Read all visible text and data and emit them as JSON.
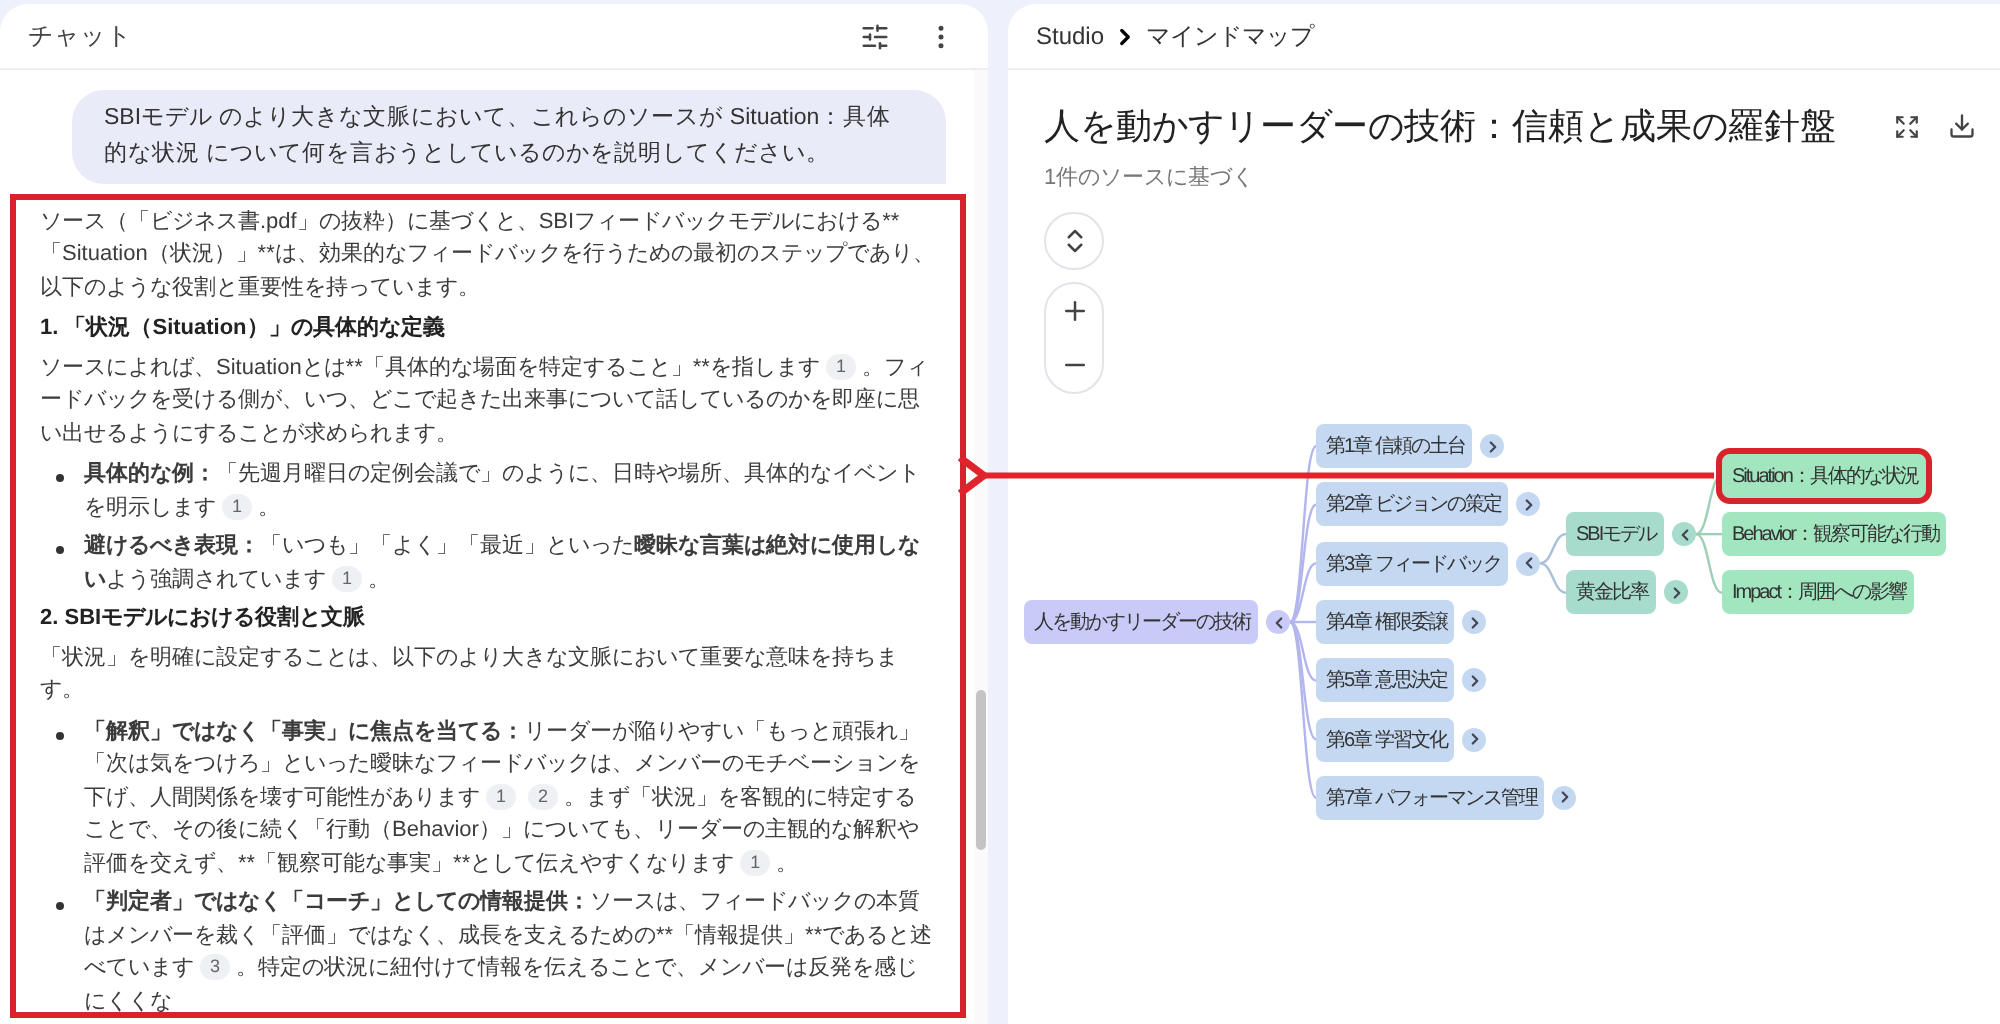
{
  "chat": {
    "title": "チャット",
    "question": "SBIモデル のより大きな文脈において、これらのソースが Situation：具体的な状況 について何を言おうとしているのかを説明してください。",
    "answer": {
      "highlighted": true,
      "blocks": [
        {
          "kind": "paragraph",
          "parts": [
            {
              "kind": "text",
              "text": "ソース（「ビジネス書.pdf」の抜粋）に基づくと、SBIフィードバックモデルにおける**「Situation（状況）」**は、効果的なフィードバックを行うための最初のステップであり、以下のような役割と重要性を持っています。"
            }
          ]
        },
        {
          "kind": "heading",
          "text": "1. 「状況（Situation）」の具体的な定義"
        },
        {
          "kind": "paragraph",
          "parts": [
            {
              "kind": "text",
              "text": "ソースによれば、Situationとは**「具体的な場面を特定すること」**を指します"
            },
            {
              "kind": "cite",
              "text": "1"
            },
            {
              "kind": "text",
              "text": "。フィードバックを受ける側が、いつ、どこで起きた出来事について話しているのかを即座に思い出せるようにすることが求められます。"
            }
          ]
        },
        {
          "kind": "bullet",
          "parts": [
            {
              "kind": "bold",
              "text": "具体的な例："
            },
            {
              "kind": "text",
              "text": "「先週月曜日の定例会議で」のように、日時や場所、具体的なイベントを明示します"
            },
            {
              "kind": "cite",
              "text": "1"
            },
            {
              "kind": "text",
              "text": "。"
            }
          ]
        },
        {
          "kind": "bullet",
          "parts": [
            {
              "kind": "bold",
              "text": "避けるべき表現："
            },
            {
              "kind": "text",
              "text": "「いつも」「よく」「最近」といった"
            },
            {
              "kind": "bold",
              "text": "曖昧な言葉は絶対に使用しない"
            },
            {
              "kind": "text",
              "text": "よう強調されています"
            },
            {
              "kind": "cite",
              "text": "1"
            },
            {
              "kind": "text",
              "text": "。"
            }
          ]
        },
        {
          "kind": "heading",
          "text": "2. SBIモデルにおける役割と文脈"
        },
        {
          "kind": "paragraph",
          "parts": [
            {
              "kind": "text",
              "text": "「状況」を明確に設定することは、以下のより大きな文脈において重要な意味を持ちます。"
            }
          ]
        },
        {
          "kind": "bullet",
          "parts": [
            {
              "kind": "bold",
              "text": "「解釈」ではなく「事実」に焦点を当てる："
            },
            {
              "kind": "text",
              "text": "リーダーが陥りやすい「もっと頑張れ」「次は気をつけろ」といった曖昧なフィードバックは、メンバーのモチベーションを下げ、人間関係を壊す可能性があります"
            },
            {
              "kind": "cite",
              "text": "1"
            },
            {
              "kind": "cite",
              "text": "2"
            },
            {
              "kind": "text",
              "text": "。まず「状況」を客観的に特定することで、その後に続く「行動（Behavior）」についても、リーダーの主観的な解釈や評価を交えず、**「観察可能な事実」**として伝えやすくなります"
            },
            {
              "kind": "cite",
              "text": "1"
            },
            {
              "kind": "text",
              "text": "。"
            }
          ]
        },
        {
          "kind": "bullet",
          "parts": [
            {
              "kind": "bold",
              "text": "「判定者」ではなく「コーチ」としての情報提供："
            },
            {
              "kind": "text",
              "text": "ソースは、フィードバックの本質はメンバーを裁く「評価」ではなく、成長を支えるための**「情報提供」**であると述べています"
            },
            {
              "kind": "cite",
              "text": "3"
            },
            {
              "kind": "text",
              "text": "。特定の状況に紐付けて情報を伝えることで、メンバーは反発を感じにくくな"
            }
          ]
        }
      ]
    }
  },
  "studio": {
    "breadcrumb": [
      "Studio",
      "マインドマップ"
    ],
    "title": "人を動かすリーダーの技術：信頼と成果の羅針盤",
    "subtitle": "1件のソースに基づく",
    "mindmap": {
      "root": {
        "label": "人を動かすリーダーの技術",
        "expanded": true,
        "children": [
          {
            "label": "第1章 信頼の土台",
            "expanded": false
          },
          {
            "label": "第2章 ビジョンの策定",
            "expanded": false
          },
          {
            "label": "第3章 フィードバック",
            "expanded": true,
            "children": [
              {
                "label": "SBIモデル",
                "expanded": true,
                "children": [
                  {
                    "label": "Situation：具体的な状況",
                    "highlighted": true
                  },
                  {
                    "label": "Behavior：観察可能な行動",
                    "highlighted": false
                  },
                  {
                    "label": "Impact：周囲への影響",
                    "highlighted": false
                  }
                ]
              },
              {
                "label": "黄金比率",
                "expanded": false
              }
            ]
          },
          {
            "label": "第4章 権限委譲",
            "expanded": false
          },
          {
            "label": "第5章 意思決定",
            "expanded": false
          },
          {
            "label": "第6章 学習文化",
            "expanded": false
          },
          {
            "label": "第7章 パフォーマンス管理",
            "expanded": false
          }
        ]
      }
    }
  }
}
